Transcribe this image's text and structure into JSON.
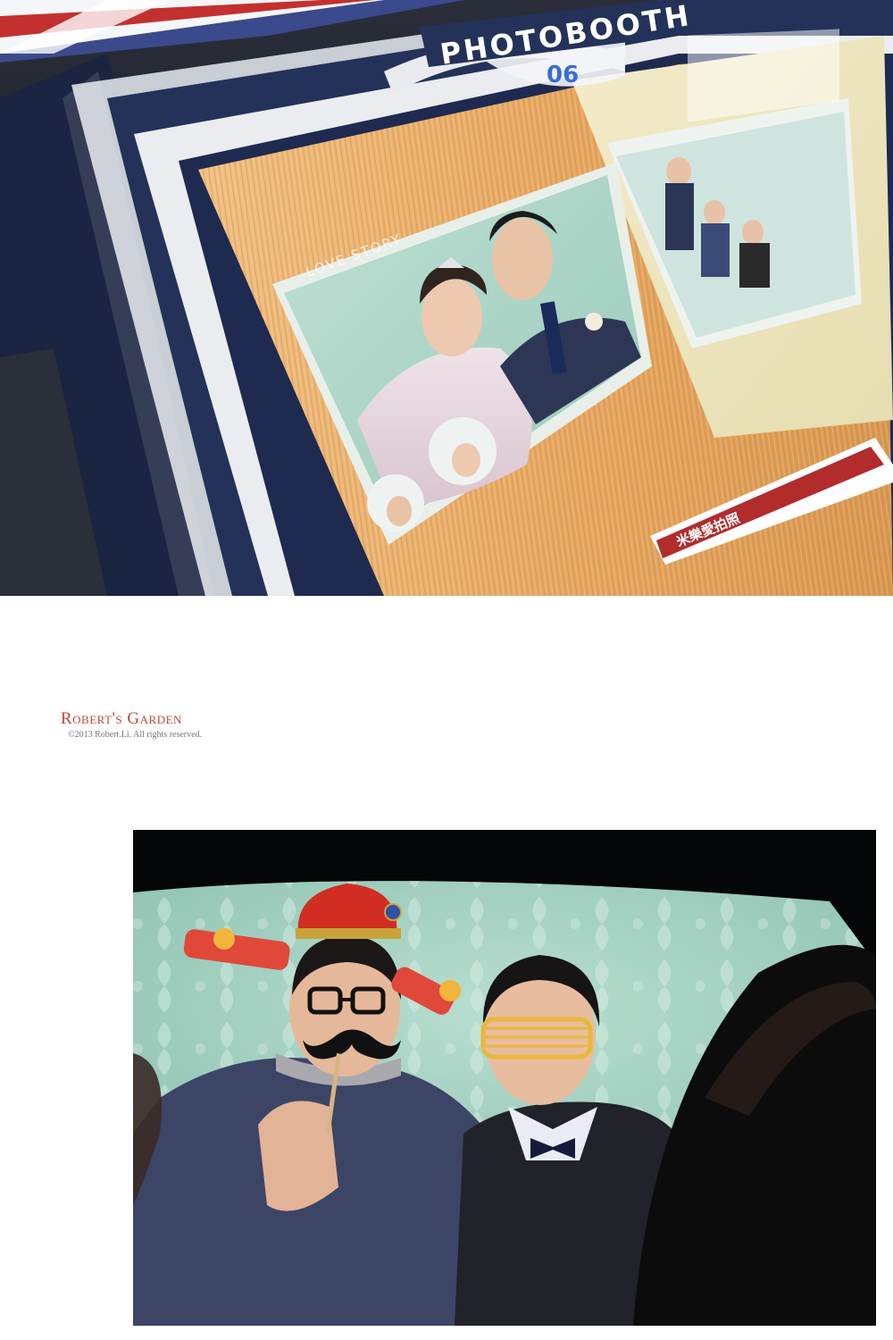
{
  "photobooth_screen": {
    "header_text": "PHOTOBOOTH",
    "frame_number": "06",
    "print_label": "LOVE STORY",
    "banner_text": "米樂愛拍照"
  },
  "watermark": {
    "title": "Robert's Garden",
    "subtitle": "©2013 Robert.Li. All rights reserved."
  },
  "colors": {
    "wood": "#e4a460",
    "mint_backdrop": "#a9d3c6",
    "frame_navy": "#243259",
    "brand_red": "#c1463c"
  }
}
